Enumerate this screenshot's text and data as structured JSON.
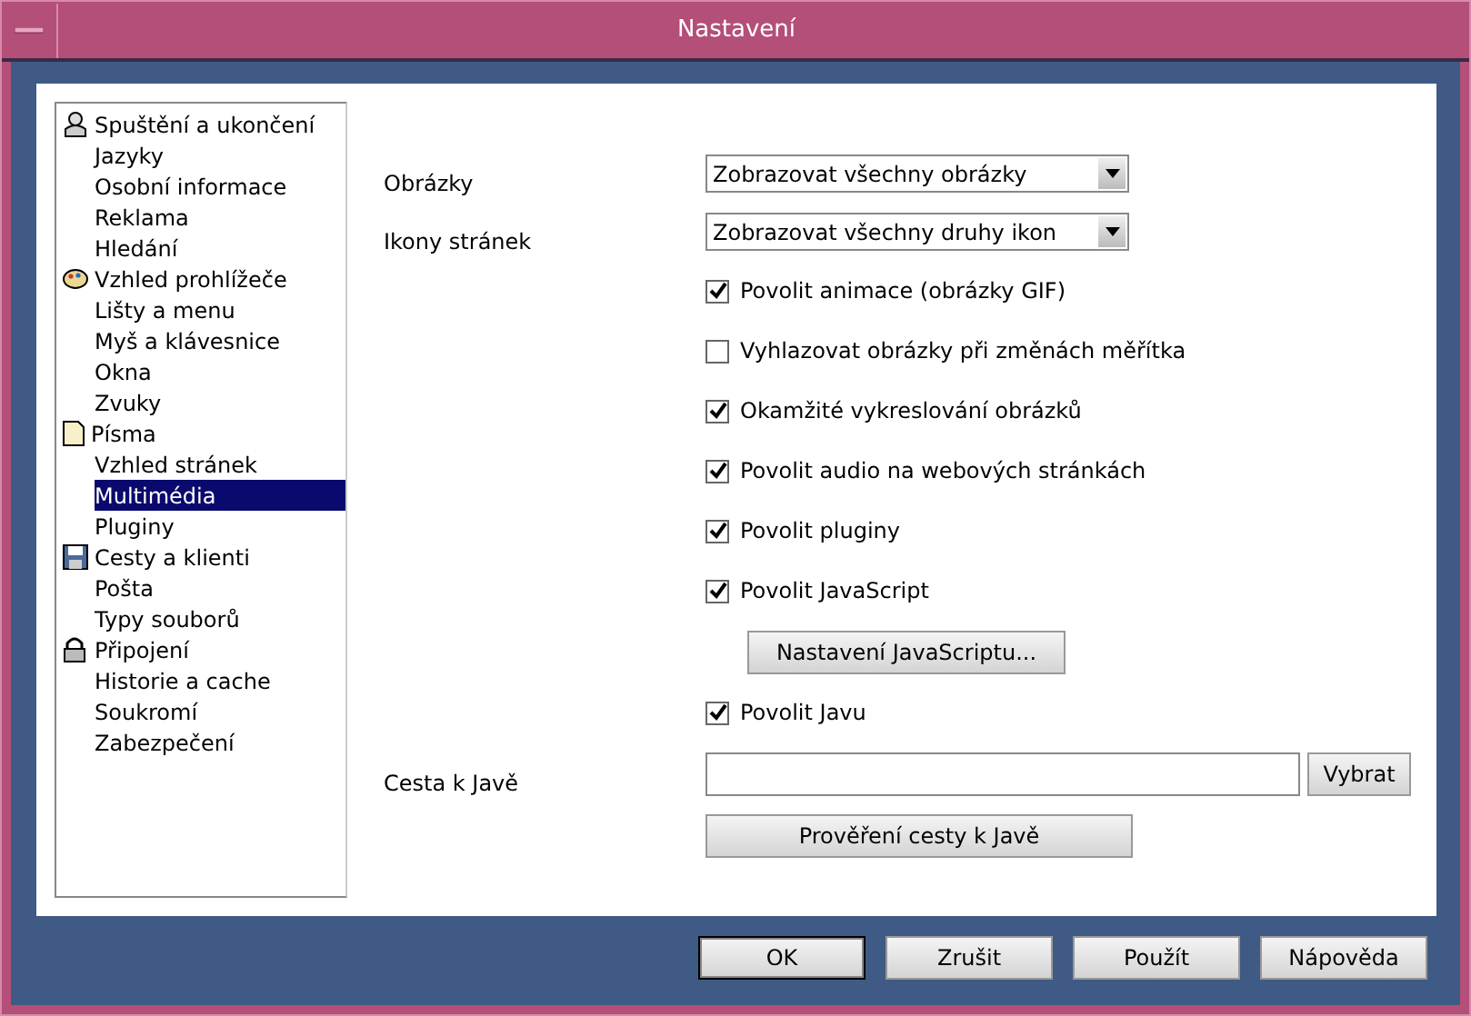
{
  "window": {
    "title": "Nastavení"
  },
  "sidebar": {
    "items": [
      {
        "label": "Spuštění a ukončení",
        "selected": false,
        "children": [
          {
            "label": "Jazyky",
            "selected": false
          },
          {
            "label": "Osobní informace",
            "selected": false
          },
          {
            "label": "Reklama",
            "selected": false
          },
          {
            "label": "Hledání",
            "selected": false
          }
        ]
      },
      {
        "label": "Vzhled prohlížeče",
        "selected": false,
        "children": [
          {
            "label": "Lišty a menu",
            "selected": false
          },
          {
            "label": "Myš a klávesnice",
            "selected": false
          },
          {
            "label": "Okna",
            "selected": false
          },
          {
            "label": "Zvuky",
            "selected": false
          }
        ]
      },
      {
        "label": "Písma",
        "selected": false,
        "children": [
          {
            "label": "Vzhled stránek",
            "selected": false
          },
          {
            "label": "Multimédia",
            "selected": true
          },
          {
            "label": "Pluginy",
            "selected": false
          }
        ]
      },
      {
        "label": "Cesty a klienti",
        "selected": false,
        "children": [
          {
            "label": "Pošta",
            "selected": false
          },
          {
            "label": "Typy souborů",
            "selected": false
          }
        ]
      },
      {
        "label": "Připojení",
        "selected": false,
        "children": [
          {
            "label": "Historie a cache",
            "selected": false
          },
          {
            "label": "Soukromí",
            "selected": false
          },
          {
            "label": "Zabezpečení",
            "selected": false
          }
        ]
      }
    ]
  },
  "settings": [
    {
      "kind": "select",
      "label": "Obrázky",
      "value": "Zobrazovat všechny obrázky"
    },
    {
      "kind": "select",
      "label": "Ikony stránek",
      "value": "Zobrazovat všechny druhy ikon"
    },
    {
      "kind": "checkbox",
      "label": "Povolit animace (obrázky GIF)",
      "checked": true
    },
    {
      "kind": "checkbox",
      "label": "Vyhlazovat obrázky při změnách měřítka",
      "checked": false
    },
    {
      "kind": "checkbox",
      "label": "Okamžité vykreslování obrázků",
      "checked": true
    },
    {
      "kind": "checkbox",
      "label": "Povolit audio na webových stránkách",
      "checked": true
    },
    {
      "kind": "checkbox",
      "label": "Povolit pluginy",
      "checked": true
    },
    {
      "kind": "checkbox",
      "label": "Povolit JavaScript",
      "checked": true
    },
    {
      "kind": "button",
      "label": "Nastavení JavaScriptu..."
    },
    {
      "kind": "checkbox",
      "label": "Povolit Javu",
      "checked": true
    },
    {
      "kind": "path",
      "label": "Cesta k Javě",
      "button": "Vybrat"
    },
    {
      "kind": "widebutton",
      "label": "Prověření cesty k Javě"
    }
  ],
  "buttons": [
    {
      "label": "OK",
      "default": true
    },
    {
      "label": "Zrušit",
      "default": false
    },
    {
      "label": "Použít",
      "default": false
    },
    {
      "label": "Nápověda",
      "default": false
    }
  ]
}
